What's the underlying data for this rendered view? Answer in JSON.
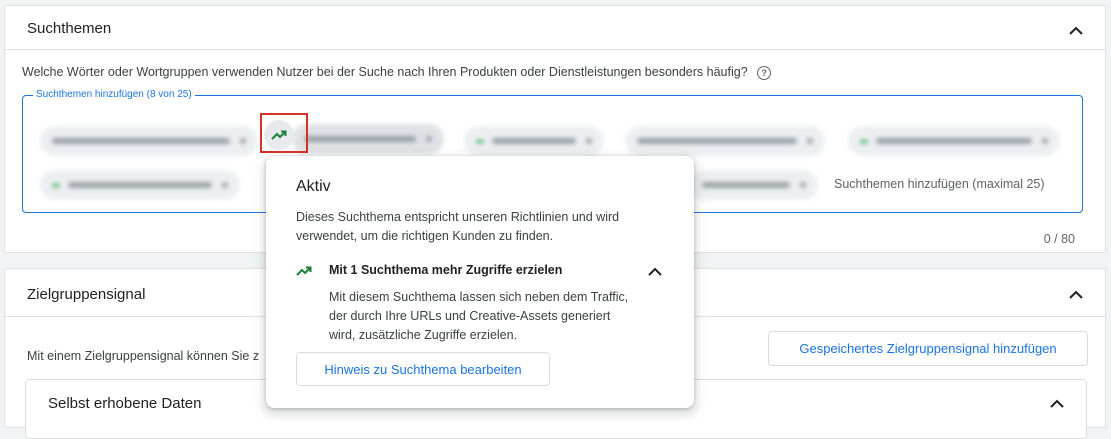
{
  "search_themes": {
    "title": "Suchthemen",
    "question": "Welche Wörter oder Wortgruppen verwenden Nutzer bei der Suche nach Ihren Produkten oder Dienstleistungen besonders häufig?",
    "field_label": "Suchthemen hinzufügen (8 von 25)",
    "add_placeholder": "Suchthemen hinzufügen (maximal 25)",
    "counter": "0 / 80"
  },
  "popup": {
    "title": "Aktiv",
    "description": "Dieses Suchthema entspricht unseren Richtlinien und wird verwendet, um die richtigen Kunden zu finden.",
    "subtitle": "Mit 1 Suchthema mehr Zugriffe erzielen",
    "body": "Mit diesem Suchthema lassen sich neben dem Traffic, der durch Ihre URLs und Creative-Assets generiert wird, zusätzliche Zugriffe erzielen.",
    "edit_button": "Hinweis zu Suchthema bearbeiten"
  },
  "audience_signal": {
    "title": "Zielgruppensignal",
    "intro": "Mit einem Zielgruppensignal können Sie z",
    "saved_button": "Gespeichertes Zielgruppensignal hinzufügen",
    "section_title": "Selbst erhobene Daten"
  },
  "colors": {
    "accent": "#1a73e8",
    "trend_green": "#188038",
    "highlight_red": "#d93025"
  }
}
